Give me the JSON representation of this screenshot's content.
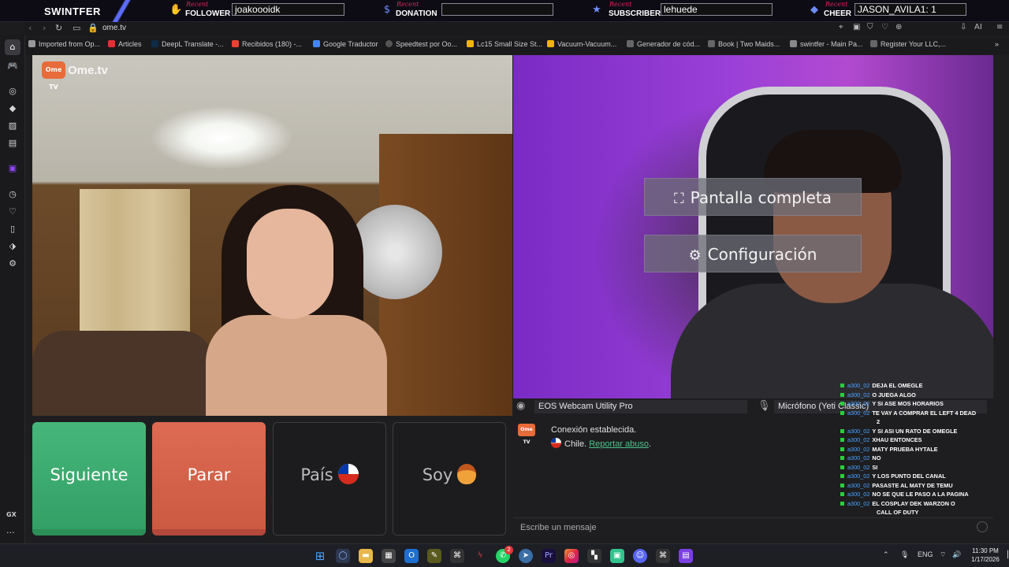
{
  "overlay": {
    "brand": "SWINTFER",
    "recent_word": "Recent",
    "follower": {
      "type": "FOLLOWER",
      "value": "joakoooidk"
    },
    "donation": {
      "type": "DONATION",
      "value": ""
    },
    "subscriber": {
      "type": "SUBSCRIBER",
      "value": "lehuede"
    },
    "cheer": {
      "type": "CHEER",
      "value": "JASON_AVILA1: 1"
    },
    "accent_color": "#5b6cff"
  },
  "browser": {
    "url": "ome.tv",
    "bookmarks": [
      {
        "label": "Imported from Op...",
        "icon": "folder-icon"
      },
      {
        "label": "Articles",
        "icon": "bookmark-icon"
      },
      {
        "label": "DeepL Translate -...",
        "icon": "deepl-icon"
      },
      {
        "label": "Recibidos (180) -...",
        "icon": "gmail-icon"
      },
      {
        "label": "Google Traductor",
        "icon": "translate-icon"
      },
      {
        "label": "Speedtest por Oo...",
        "icon": "speedtest-icon"
      },
      {
        "label": "Lc15 Small Size St...",
        "icon": "shop-icon"
      },
      {
        "label": "Vacuum-Vacuum...",
        "icon": "shop-icon"
      },
      {
        "label": "Generador de cód...",
        "icon": "globe-icon"
      },
      {
        "label": "Book | Two Maids...",
        "icon": "globe-icon"
      },
      {
        "label": "swintfer - Main Pa...",
        "icon": "streamlabs-icon"
      },
      {
        "label": "Register Your LLC,...",
        "icon": "globe-icon"
      }
    ]
  },
  "ometv": {
    "logo_badge": "Ome TV",
    "logo_text": "Ome.tv",
    "menu": {
      "fullscreen": "Pantalla completa",
      "settings": "Configuración"
    },
    "devices": {
      "camera": "EOS Webcam Utility Pro",
      "microphone": "Micrófono (Yeti Classic)"
    },
    "controls": {
      "next": "Siguiente",
      "stop": "Parar",
      "country": "País",
      "me": "Soy"
    },
    "chat": {
      "status": "Conexión establecida.",
      "country": "Chile.",
      "report_link": "Reportar abuso",
      "placeholder": "Escribe un mensaje"
    },
    "colors": {
      "next": "#3fae72",
      "stop": "#d4624a"
    }
  },
  "stream_chat": [
    {
      "user": "a300_02",
      "msg": "DEJA EL OMEGLE"
    },
    {
      "user": "a300_02",
      "msg": "O JUEGA ALGO"
    },
    {
      "user": "a300_02",
      "msg": "Y SI ASE MOS HORARIOS"
    },
    {
      "user": "a300_02",
      "msg": "TE VAY A COMPRAR EL LEFT 4 DEAD",
      "cont": "2"
    },
    {
      "user": "a300_02",
      "msg": "Y SI ASI UN RATO DE OMEGLE"
    },
    {
      "user": "a300_02",
      "msg": "XHAU ENTONCES"
    },
    {
      "user": "a300_02",
      "msg": "MATY PRUEBA HYTALE"
    },
    {
      "user": "a300_02",
      "msg": "NO"
    },
    {
      "user": "a300_02",
      "msg": "SI"
    },
    {
      "user": "a300_02",
      "msg": "Y LOS PUNTO DEL CANAL"
    },
    {
      "user": "a300_02",
      "msg": "PASASTE AL MATY DE TEMU"
    },
    {
      "user": "a300_02",
      "msg": "NO SE QUE LE PASO A LA PAGINA"
    },
    {
      "user": "a300_02",
      "msg": "EL COSPLAY DEK WARZON O",
      "cont": "CALL OF DUTY"
    }
  ],
  "taskbar": {
    "language": "ENG",
    "time": "11:30 PM",
    "date": "1/17/2026",
    "whatsapp_badge": "2"
  }
}
